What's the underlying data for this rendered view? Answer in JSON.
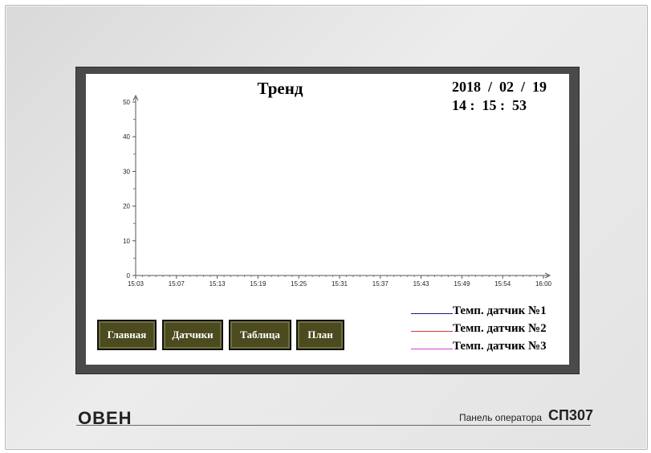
{
  "screen": {
    "title": "Тренд",
    "date": "2018  /  02  /  19",
    "time": "14 :  15 :  53"
  },
  "buttons": [
    {
      "label": "Главная"
    },
    {
      "label": "Датчики"
    },
    {
      "label": "Таблица"
    },
    {
      "label": "План"
    }
  ],
  "legend": [
    {
      "label": "Темп. датчик №1",
      "color": "#1a1a8c"
    },
    {
      "label": "Темп. датчик №2",
      "color": "#d23a3a"
    },
    {
      "label": "Темп. датчик №3",
      "color": "#d040d0"
    }
  ],
  "chart_data": {
    "type": "line",
    "x_tick_labels": [
      "15:03",
      "15:07",
      "15:13",
      "15:19",
      "15:25",
      "15:31",
      "15:37",
      "15:43",
      "15:49",
      "15:54",
      "16:00"
    ],
    "y_tick_labels": [
      "0",
      "10",
      "20",
      "30",
      "40",
      "50"
    ],
    "ylim": [
      0,
      50
    ],
    "series": []
  },
  "footer": {
    "brand": "ОВЕН",
    "panel_label": "Панель оператора",
    "model": "СП307"
  },
  "colors": {
    "button_bg": "#4b4b1f",
    "bezel": "#4a4a4a",
    "device": "#e3e3e3"
  }
}
